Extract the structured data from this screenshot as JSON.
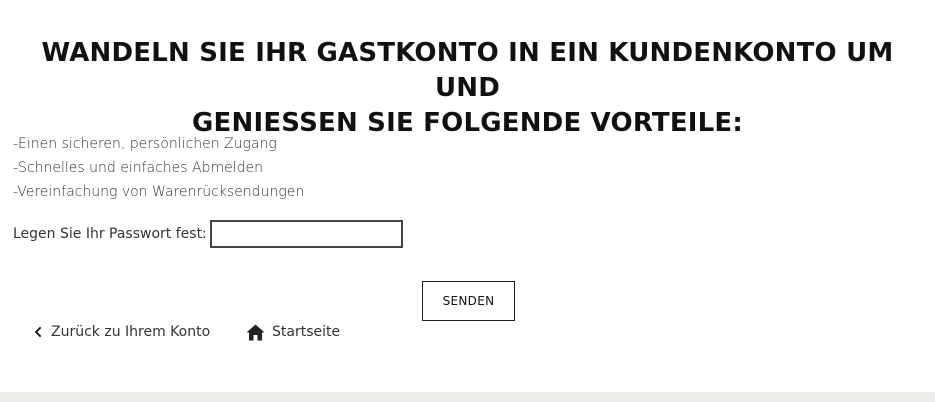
{
  "heading": {
    "line1": "WANDELN SIE IHR GASTKONTO IN EIN KUNDENKONTO UM UND",
    "line2": "GENIESSEN SIE FOLGENDE VORTEILE:"
  },
  "benefits": [
    "-Einen sicheren, persönlichen Zugang",
    "-Schnelles und einfaches Abmelden",
    "-Vereinfachung von Warenrücksendungen"
  ],
  "password": {
    "label": "Legen Sie Ihr Passwort fest:",
    "value": "",
    "placeholder": ""
  },
  "submit_label": "SENDEN",
  "nav": {
    "back": {
      "label": "Zurück zu Ihrem Konto",
      "icon": "chevron-left-icon"
    },
    "home": {
      "label": "Startseite",
      "icon": "home-icon"
    }
  },
  "colors": {
    "text": "#333333",
    "heading": "#111111",
    "footer_band": "#efedea"
  }
}
